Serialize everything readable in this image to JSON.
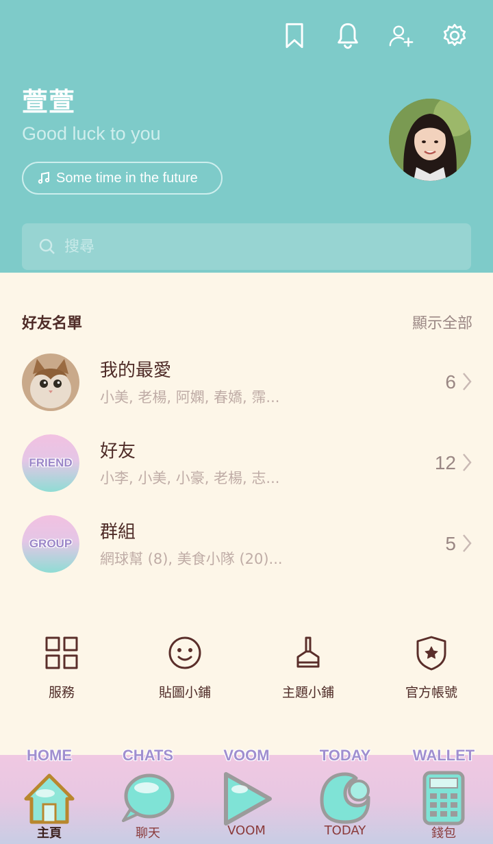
{
  "header": {
    "profile_name": "萱萱",
    "status_message": "Good luck to you",
    "music": "Some time in the future",
    "search_placeholder": "搜尋"
  },
  "friends_section": {
    "title": "好友名單",
    "show_all": "顯示全部",
    "rows": [
      {
        "name": "我的最愛",
        "members": "小美, 老楊, 阿嫻, 春嬌, 霈...",
        "count": "6"
      },
      {
        "name": "好友",
        "members": "小李, 小美, 小豪, 老楊, 志...",
        "count": "12",
        "badge": "FRIEND"
      },
      {
        "name": "群組",
        "members": "網球幫 (8), 美食小隊 (20)...",
        "count": "5",
        "badge": "GROUP"
      }
    ]
  },
  "shortcuts": [
    {
      "label": "服務",
      "icon": "grid-icon"
    },
    {
      "label": "貼圖小鋪",
      "icon": "smiley-icon"
    },
    {
      "label": "主題小鋪",
      "icon": "brush-icon"
    },
    {
      "label": "官方帳號",
      "icon": "shield-star-icon"
    }
  ],
  "bottom_nav": [
    {
      "en": "HOME",
      "label": "主頁",
      "icon": "home-icon",
      "active": true
    },
    {
      "en": "CHATS",
      "label": "聊天",
      "icon": "chat-bubble-icon"
    },
    {
      "en": "VOOM",
      "label": "VOOM",
      "icon": "play-icon"
    },
    {
      "en": "TODAY",
      "label": "TODAY",
      "icon": "today-icon"
    },
    {
      "en": "WALLET",
      "label": "錢包",
      "icon": "calculator-icon"
    }
  ],
  "colors": {
    "header_bg": "#7ecbc9",
    "body_bg": "#fdf6e8",
    "text_dark": "#4e2b27"
  }
}
